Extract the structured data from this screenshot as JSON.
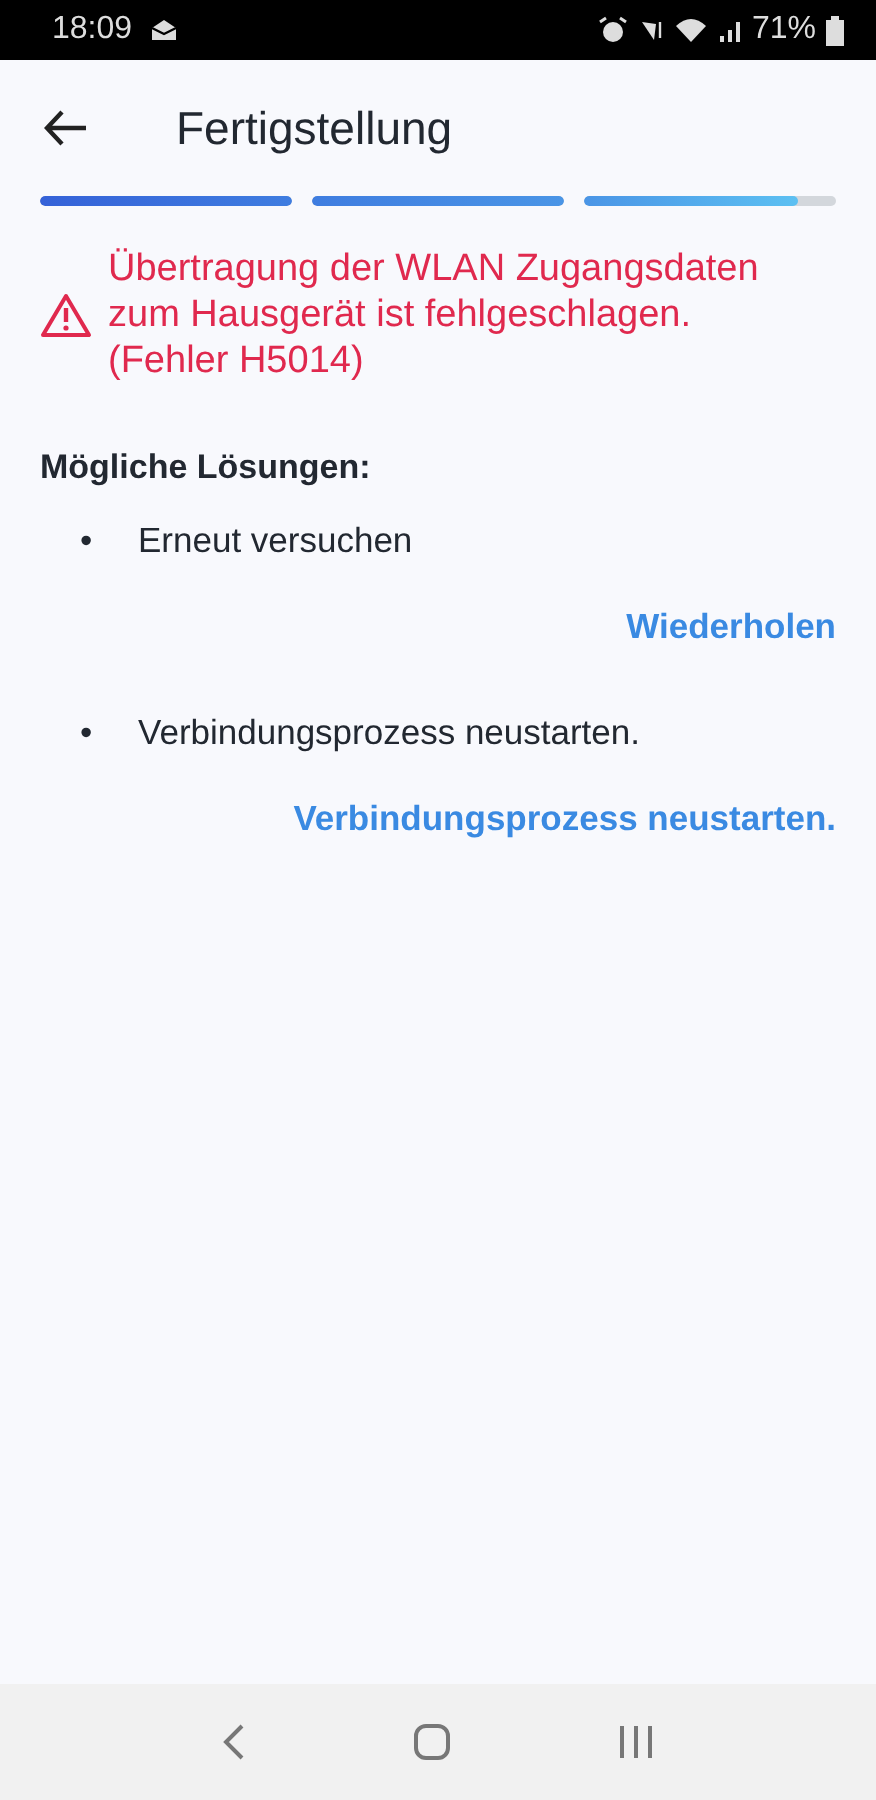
{
  "status_bar": {
    "time": "18:09",
    "battery": "71%"
  },
  "header": {
    "title": "Fertigstellung"
  },
  "progress": [
    {
      "level": 1
    },
    {
      "level": 1
    },
    {
      "level": 0.85
    }
  ],
  "error": {
    "message": "Übertragung der WLAN Zugangsdaten zum Hausgerät ist fehlgeschlagen. (Fehler H5014)"
  },
  "solutions": {
    "heading": "Mögliche Lösungen:",
    "items": [
      {
        "bullet": "•",
        "text": "Erneut versuchen",
        "action": "Wiederholen"
      },
      {
        "bullet": "•",
        "text": "Verbindungsprozess neustarten.",
        "action": "Verbindungsprozess neustarten."
      }
    ]
  }
}
